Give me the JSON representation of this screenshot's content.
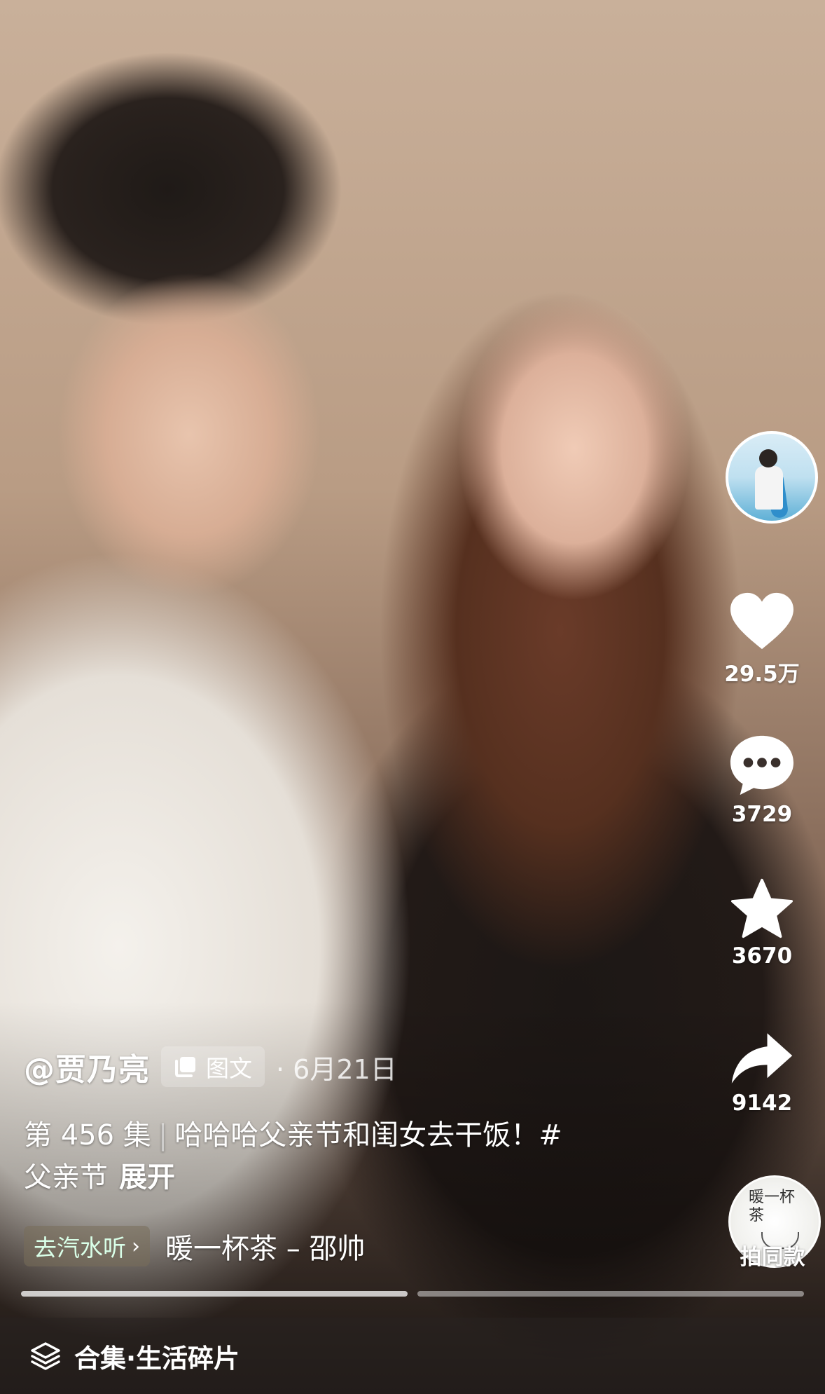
{
  "video": {
    "author": "@贾乃亮",
    "type_tag": "图文",
    "date": "· 6月21日",
    "caption": {
      "episode": "第 456 集",
      "separator": "|",
      "text_line1": "哈哈哈父亲节和闺女去干饭！#",
      "text_line2": "父亲节",
      "expand": "展开"
    },
    "music": {
      "chip": "去汽水听",
      "chevron": "›",
      "title": "暖一杯茶 – 邵帅"
    },
    "collection": "合集·生活碎片",
    "progress_segments": 2
  },
  "actions": {
    "likes": "29.5万",
    "comments": "3729",
    "favorites": "3670",
    "shares": "9142",
    "same_style": "拍同款",
    "disc_art_text": "暖一杯茶"
  },
  "icons": {
    "avatar": "avatar-surfboard-photo",
    "like": "heart-icon",
    "comment": "comment-bubble-icon",
    "favorite": "star-icon",
    "share": "share-arrow-icon",
    "music_disc": "music-disc-icon",
    "type": "gallery-icon",
    "collection": "stack-icon"
  },
  "colors": {
    "icon_fill": "#ffffff",
    "music_chip_text": "#d9ffe8"
  }
}
